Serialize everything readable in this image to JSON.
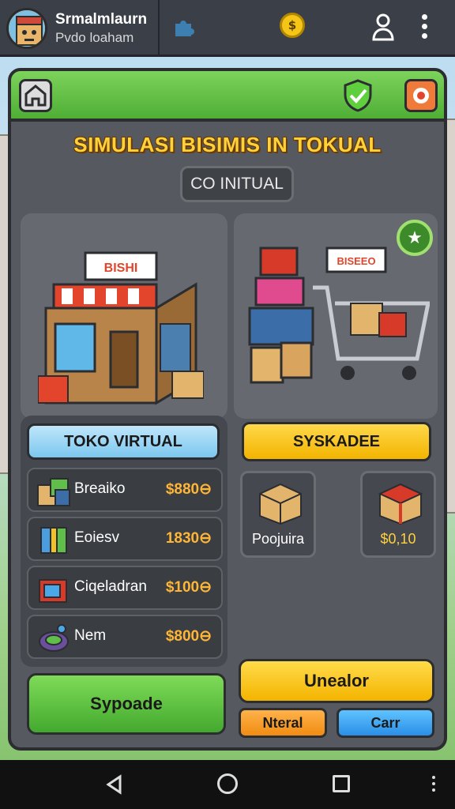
{
  "app": {
    "title": "Srmalmlaurn",
    "subtitle": "Pvdo loaham",
    "coin_symbol": "$"
  },
  "panel": {
    "title": "SIMULASI BISIMIS IN TOKUAL",
    "subtitle_box": "CO INITUAL",
    "store_sign": "BISHI",
    "cart_sign": "BISEEO"
  },
  "left_column": {
    "header_button": "TOKO VIRTUAL",
    "items": [
      {
        "name": "Breaiko",
        "price": "$880⊖",
        "icon": "stacked-boxes-icon"
      },
      {
        "name": "Eoiesv",
        "price": "1830⊖",
        "icon": "colorful-cube-icon"
      },
      {
        "name": "Ciqeladran",
        "price": "$100⊖",
        "icon": "gift-box-icon"
      },
      {
        "name": "Nem",
        "price": "$800⊖",
        "icon": "bag-icon"
      }
    ]
  },
  "right_column": {
    "header_button": "SYSKADEE",
    "cards": [
      {
        "label": "Poojuira",
        "icon": "cardboard-box-icon"
      },
      {
        "label": "$0,10",
        "icon": "red-package-icon"
      }
    ]
  },
  "actions": {
    "green": "Sypoade",
    "yellow": "Unealor",
    "orange": "Nteral",
    "blue": "Carr"
  },
  "colors": {
    "accent_green": "#4fae35",
    "accent_yellow": "#f3b400",
    "panel_bg": "#56595f",
    "price_orange": "#ffb637"
  }
}
